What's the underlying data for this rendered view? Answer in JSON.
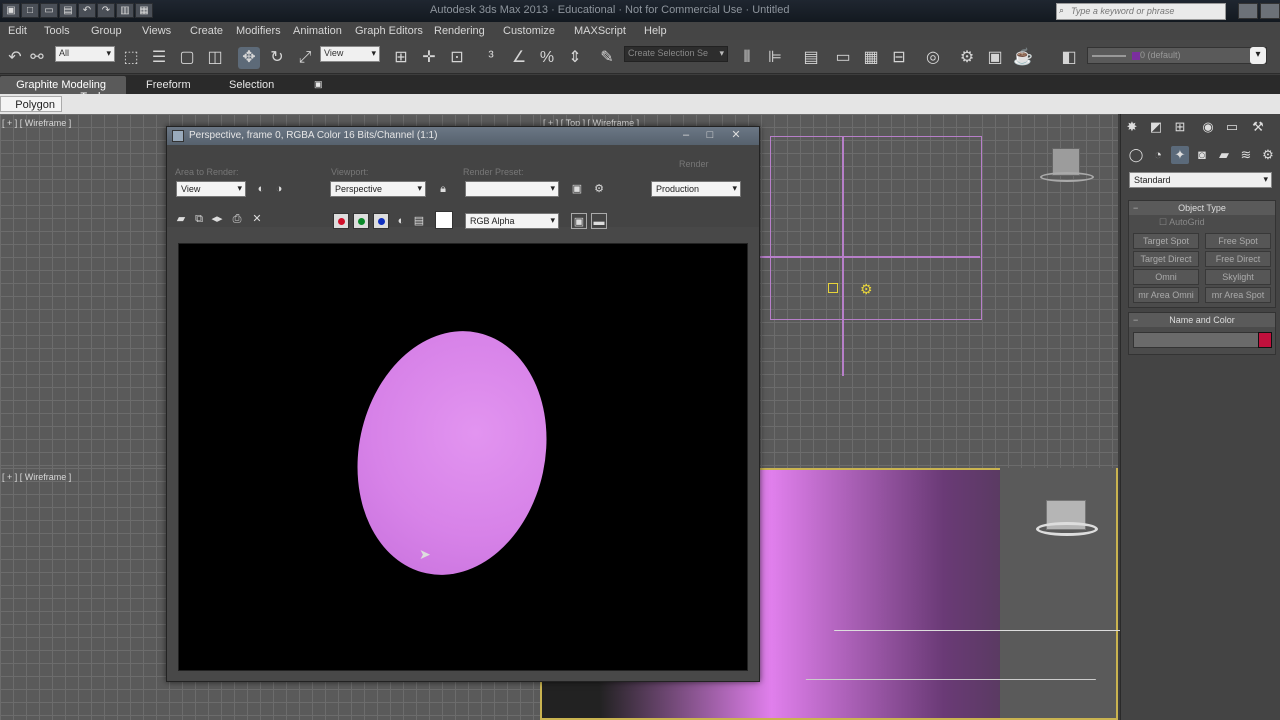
{
  "app": {
    "title": "Autodesk 3ds Max 2013 · Educational · Not for Commercial Use · Untitled",
    "search_placeholder": "Type a keyword or phrase"
  },
  "menu": [
    "Edit",
    "Tools",
    "Group",
    "Views",
    "Create",
    "Modifiers",
    "Animation",
    "Graph Editors",
    "Rendering",
    "Customize",
    "MAXScript",
    "Help"
  ],
  "toolbar": {
    "selection_filter": "All",
    "ref_coord": "View",
    "named_selection": "Create Selection Se",
    "layer": "0 (default)"
  },
  "ribbon": {
    "tabs": [
      "Graphite Modeling Tools",
      "Freeform",
      "Selection"
    ],
    "subtab": "Polygon Modeling"
  },
  "viewports": {
    "top_left_label": "[ + ] [ Wireframe ]",
    "bottom_left_label": "[ + ] [ Wireframe ]",
    "top_right_label": "[ + ] [ Top ] [ Wireframe ]"
  },
  "command_panel": {
    "category": "Standard",
    "object_type_title": "Object Type",
    "autogrid": "AutoGrid",
    "buttons": [
      "Target Spot",
      "Free Spot",
      "Target Direct",
      "Free Direct",
      "Omni",
      "Skylight",
      "mr Area Omni",
      "mr Area Spot"
    ],
    "name_color_title": "Name and Color",
    "object_color": "#c0103c"
  },
  "render_window": {
    "title": "Perspective, frame 0, RGBA Color 16 Bits/Channel (1:1)",
    "area_label": "Area to Render:",
    "area_value": "View",
    "viewport_label": "Viewport:",
    "viewport_value": "Perspective",
    "preset_label": "Render Preset:",
    "preset_value": "",
    "render_label": "Render",
    "render_value": "Production",
    "channel_value": "RGB Alpha",
    "sphere_color": "#d782e8"
  }
}
